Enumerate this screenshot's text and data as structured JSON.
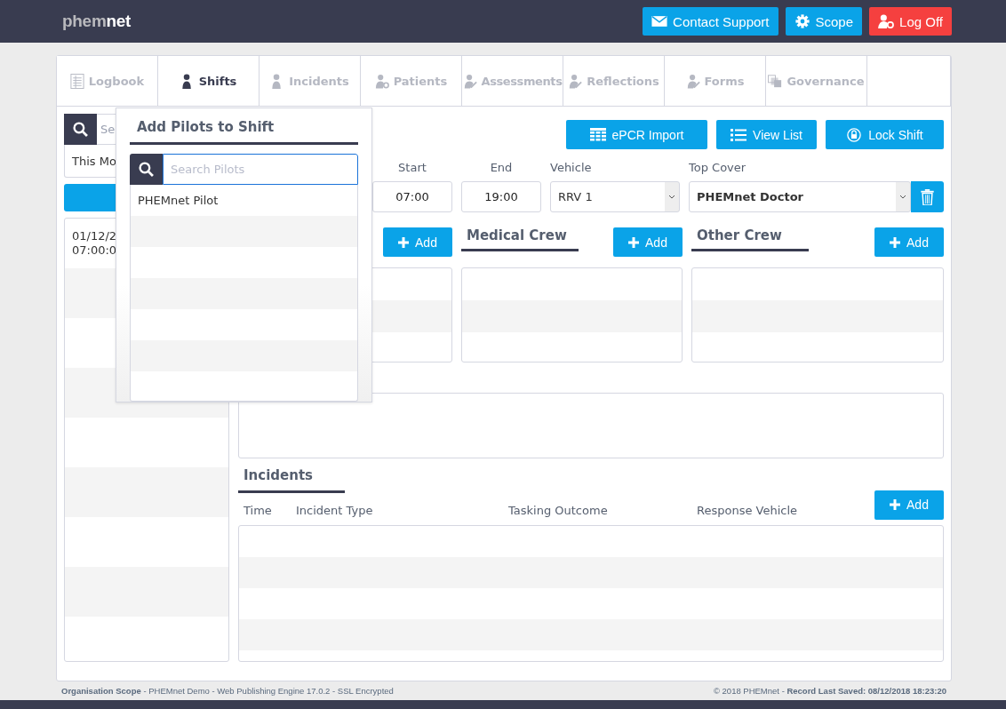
{
  "header": {
    "logo_left": "phem",
    "logo_right": "net",
    "buttons": [
      {
        "kind": "support",
        "label": "Contact Support"
      },
      {
        "kind": "scope",
        "label": "Scope"
      },
      {
        "kind": "logoff",
        "label": "Log Off"
      }
    ]
  },
  "tabs": [
    {
      "kind": "book",
      "label": "Logbook",
      "selected": false
    },
    {
      "kind": "person",
      "label": "Shifts",
      "selected": true
    },
    {
      "kind": "person",
      "label": "Incidents",
      "selected": false
    },
    {
      "kind": "person-gear",
      "label": "Patients",
      "selected": false
    },
    {
      "kind": "person-pen",
      "label": "Assessments",
      "selected": false
    },
    {
      "kind": "person-pen",
      "label": "Reflections",
      "selected": false
    },
    {
      "kind": "person-pen",
      "label": "Forms",
      "selected": false
    },
    {
      "kind": "stack",
      "label": "Governance",
      "selected": false
    }
  ],
  "sidebar": {
    "search_placeholder": "Se",
    "filter": "This Mo",
    "list": [
      {
        "line1": "01/12/2",
        "line2": "07:00:0"
      }
    ]
  },
  "toolbar": [
    {
      "kind": "grid",
      "label": "ePCR Import"
    },
    {
      "kind": "list",
      "label": "View List"
    },
    {
      "kind": "lock",
      "label": "Lock Shift"
    }
  ],
  "fields": {
    "start": {
      "label": "Start",
      "value": "07:00"
    },
    "end": {
      "label": "End",
      "value": "19:00"
    },
    "vehicle": {
      "label": "Vehicle",
      "value": "RRV 1"
    },
    "top_cover": {
      "label": "Top Cover",
      "value": "PHEMnet Doctor"
    }
  },
  "crew": [
    {
      "add": "Add"
    },
    {
      "title": "Medical Crew",
      "add": "Add"
    },
    {
      "title": "Other Crew",
      "add": "Add"
    }
  ],
  "incidents": {
    "title": "Incidents",
    "add": "Add",
    "columns": [
      "Time",
      "Incident Type",
      "Tasking Outcome",
      "Response Vehicle"
    ]
  },
  "popup": {
    "title": "Add Pilots to Shift",
    "placeholder": "Search Pilots",
    "items": [
      "PHEMnet Pilot"
    ]
  },
  "footer": {
    "left": "**Organisation Scope** - PHEMnet Demo - Web Publishing Engine 17.0.2 - SSL Encrypted",
    "right": "© 2018 PHEMnet - **Record Last Saved: 08/12/2018 18:23:20**"
  }
}
